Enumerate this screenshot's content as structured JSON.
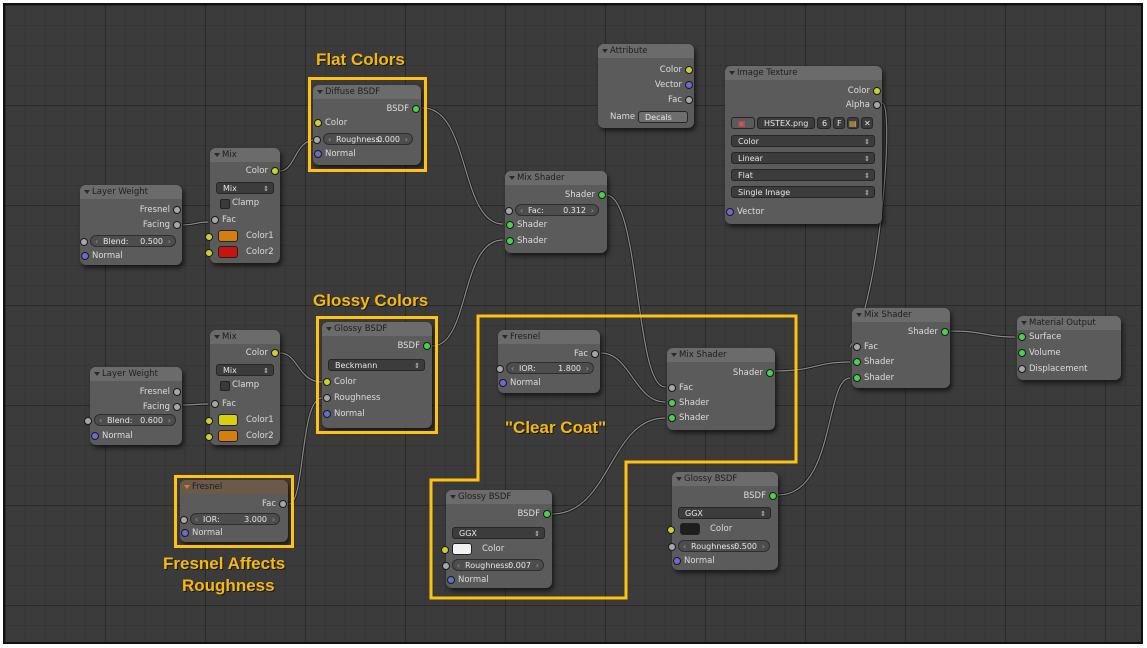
{
  "annotations": {
    "flat_colors": "Flat Colors",
    "glossy_colors": "Glossy Colors",
    "fresnel_line1": "Fresnel Affects",
    "fresnel_line2": "Roughness",
    "clear_coat": "\"Clear Coat\""
  },
  "annotation_color": "#ffc20e",
  "socket_colors": {
    "color": "#cfcf29",
    "shader": "#4ccf4c",
    "value": "#a6a6a6",
    "vector": "#6a6ad0"
  },
  "nodes": {
    "diffuse1": {
      "title": "Diffuse BSDF",
      "out_bsdf": "BSDF",
      "in_color": "Color",
      "roughness_label": "Roughness:",
      "roughness_value": "0.000",
      "in_normal": "Normal"
    },
    "mix1": {
      "title": "Mix",
      "out_color": "Color",
      "blend_mode": "Mix",
      "clamp": "Clamp",
      "in_fac": "Fac",
      "in_color1": "Color1",
      "in_color2": "Color2",
      "color1_swatch": "#d47f0a",
      "color2_swatch": "#c8140f"
    },
    "lw1": {
      "title": "Layer Weight",
      "out_fresnel": "Fresnel",
      "out_facing": "Facing",
      "blend_label": "Blend:",
      "blend_value": "0.500",
      "in_normal": "Normal"
    },
    "mixshader1": {
      "title": "Mix Shader",
      "out_shader": "Shader",
      "fac_label": "Fac:",
      "fac_value": "0.312",
      "in_shader1": "Shader",
      "in_shader2": "Shader"
    },
    "attribute": {
      "title": "Attribute",
      "out_color": "Color",
      "out_vector": "Vector",
      "out_fac": "Fac",
      "name_label": "Name",
      "name_value": "Decals"
    },
    "imagetex": {
      "title": "Image Texture",
      "out_color": "Color",
      "out_alpha": "Alpha",
      "image_name": "HSTEX.png",
      "users": "6",
      "fake": "F",
      "color_space": "Color",
      "interpolation": "Linear",
      "projection": "Flat",
      "source": "Single Image",
      "in_vector": "Vector"
    },
    "mix2": {
      "title": "Mix",
      "out_color": "Color",
      "blend_mode": "Mix",
      "clamp": "Clamp",
      "in_fac": "Fac",
      "in_color1": "Color1",
      "in_color2": "Color2",
      "color1_swatch": "#d8d00a",
      "color2_swatch": "#d47f0a"
    },
    "lw2": {
      "title": "Layer Weight",
      "out_fresnel": "Fresnel",
      "out_facing": "Facing",
      "blend_label": "Blend:",
      "blend_value": "0.600",
      "in_normal": "Normal"
    },
    "glossy1": {
      "title": "Glossy BSDF",
      "out_bsdf": "BSDF",
      "distribution": "Beckmann",
      "in_color": "Color",
      "in_roughness": "Roughness",
      "in_normal": "Normal"
    },
    "fresnel1": {
      "title": "Fresnel",
      "out_fac": "Fac",
      "ior_label": "IOR:",
      "ior_value": "3.000",
      "in_normal": "Normal"
    },
    "fresnel2": {
      "title": "Fresnel",
      "out_fac": "Fac",
      "ior_label": "IOR:",
      "ior_value": "1.800",
      "in_normal": "Normal"
    },
    "mixshader2": {
      "title": "Mix Shader",
      "out_shader": "Shader",
      "in_fac": "Fac",
      "in_shader1": "Shader",
      "in_shader2": "Shader"
    },
    "glossy2": {
      "title": "Glossy BSDF",
      "out_bsdf": "BSDF",
      "distribution": "GGX",
      "in_color": "Color",
      "color_swatch": "#f2f2f2",
      "roughness_label": "Roughness:",
      "roughness_value": "0.007",
      "in_normal": "Normal"
    },
    "glossy3": {
      "title": "Glossy BSDF",
      "out_bsdf": "BSDF",
      "distribution": "GGX",
      "in_color": "Color",
      "color_swatch": "#1e1e1e",
      "roughness_label": "Roughness:",
      "roughness_value": "0.500",
      "in_normal": "Normal"
    },
    "mixshader3": {
      "title": "Mix Shader",
      "out_shader": "Shader",
      "in_fac": "Fac",
      "in_shader1": "Shader",
      "in_shader2": "Shader"
    },
    "output": {
      "title": "Material Output",
      "in_surface": "Surface",
      "in_volume": "Volume",
      "in_displacement": "Displacement"
    }
  }
}
